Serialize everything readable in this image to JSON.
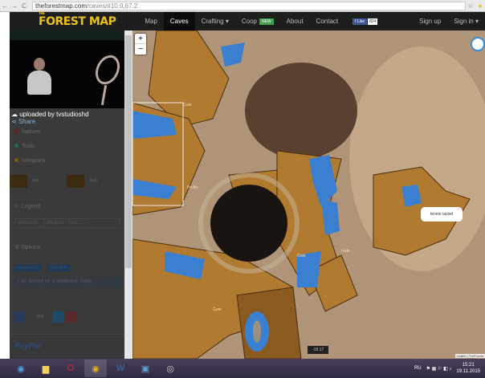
{
  "browser": {
    "url_host": "theforestmap.com",
    "url_path": "/caves/#10.0,67.2"
  },
  "navbar": {
    "logo_top": "THE",
    "logo": "FOREST MAP",
    "items": [
      "Map",
      "Caves",
      "Crafting ▾",
      "Coop",
      "About",
      "Contact"
    ],
    "new_badge": "NEW",
    "fb_like": "f Like",
    "fb_count": "824",
    "sign_up": "Sign up",
    "sign_in": "Sign in ▾"
  },
  "sidebar": {
    "uploaded_by": "uploaded by tvstudioshd",
    "share": "Share",
    "categories": [
      {
        "label": "Natives",
        "color": "#6a2020"
      },
      {
        "label": "Tools",
        "color": "#1f6a5a"
      },
      {
        "label": "Weapons",
        "color": "#7a5a10"
      }
    ],
    "weapons": [
      "Axe",
      "Gun"
    ],
    "legend": "Legend",
    "where_is": "Where is...",
    "search_placeholder": "Weapon / Tool / ...",
    "options": "Options",
    "version_tags": [
      "Version 0.22",
      "0.11.0b00"
    ],
    "moderator": "I am looking for a moderator. Apply",
    "social_count": "824",
    "paypal": "PayPal"
  },
  "map": {
    "popup": "tennis racket",
    "coords": "-19 17",
    "attribution": "Leaflet | TheForest",
    "zoom_in": "+",
    "zoom_out": "−",
    "labels": [
      "Gate",
      "Profile",
      "Gate",
      "Gate",
      "Gate"
    ]
  },
  "taskbar": {
    "lang": "RU",
    "time": "15:21",
    "date": "19.11.2015"
  }
}
